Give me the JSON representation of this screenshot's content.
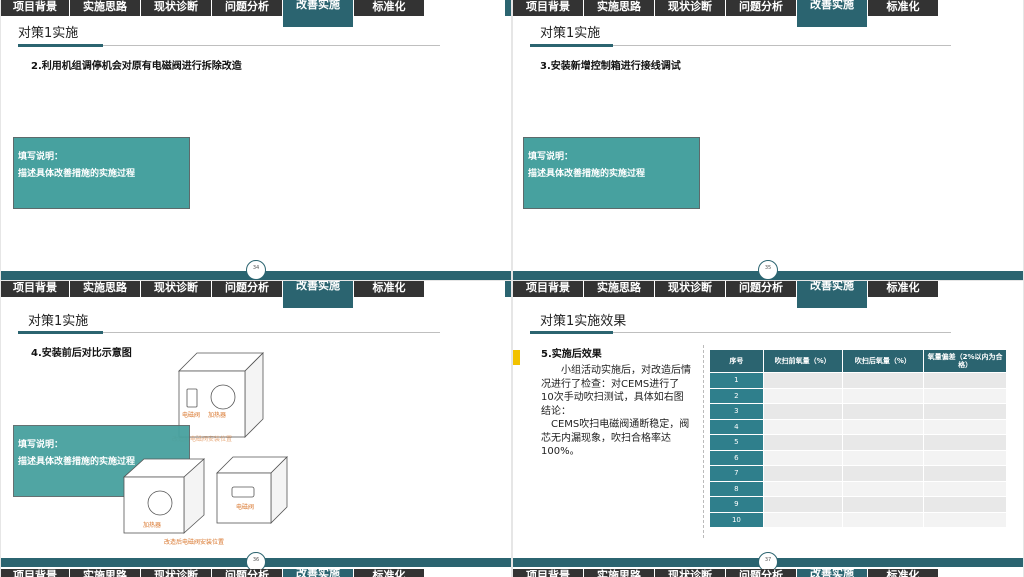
{
  "nav_tabs": [
    "项目背景",
    "实施思路",
    "现状诊断",
    "问题分析",
    "改善实施",
    "标准化"
  ],
  "active_tab": "改善实施",
  "colors": {
    "teal": "#2b6470",
    "note_bg": "#47a19f",
    "tab_bg": "#333333",
    "accent_yellow": "#f2c200"
  },
  "slides": [
    {
      "title": "对策1实施",
      "subhead": "2.利用机组调停机会对原有电磁阀进行拆除改造",
      "note_line1": "填写说明：",
      "note_line2": "描述具体改善措施的实施过程",
      "page": "34"
    },
    {
      "title": "对策1实施",
      "subhead": "3.安装新增控制箱进行接线调试",
      "note_line1": "填写说明：",
      "note_line2": "描述具体改善措施的实施过程",
      "page": "35"
    },
    {
      "title": "对策1实施",
      "subhead": "4.安装前后对比示意图",
      "note_line1": "填写说明：",
      "note_line2": "描述具体改善措施的实施过程",
      "page": "36",
      "labels": {
        "valve": "电磁阀",
        "heater": "加热器",
        "before_caption": "改造前电磁阀安装位置",
        "after_heater": "加热器",
        "after_valve": "电磁阀",
        "after_caption": "改造后电磁阀安装位置"
      }
    },
    {
      "title": "对策1实施效果",
      "page": "37",
      "heading": "5.实施后效果",
      "para1": "小组活动实施后，对改造后情况进行了检查：对CEMS进行了10次手动吹扫测试，具体如右图",
      "conclusion_label": "结论：",
      "para2": "CEMS吹扫电磁阀通断稳定，阀芯无内漏现象，吹扫合格率达100%。",
      "table": {
        "headers": [
          "序号",
          "吹扫前氧量（%）",
          "吹扫后氧量（%）",
          "氧量偏差（2%以内为合格）"
        ],
        "rows": [
          "1",
          "2",
          "3",
          "4",
          "5",
          "6",
          "7",
          "8",
          "9",
          "10"
        ]
      }
    }
  ]
}
